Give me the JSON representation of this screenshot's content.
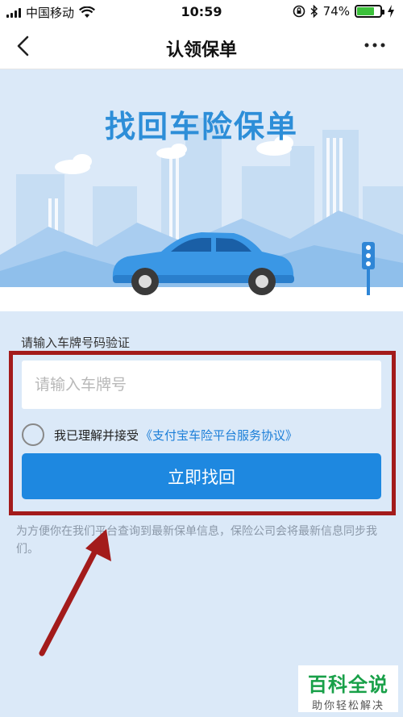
{
  "status_bar": {
    "carrier": "中国移动",
    "time": "10:59",
    "battery": "74%",
    "battery_level": 0.74,
    "icons": [
      "signal-icon",
      "wifi-icon",
      "rotation-lock-icon",
      "bluetooth-icon",
      "battery-icon",
      "charging-icon"
    ]
  },
  "nav": {
    "title": "认领保单",
    "back_icon": "chevron-left-icon",
    "more_icon": "more-dots-icon"
  },
  "banner": {
    "title": "找回车险保单",
    "illustration": "car-city-illustration"
  },
  "form": {
    "label": "请输入车牌号码验证",
    "plate_placeholder": "请输入车牌号",
    "plate_value": "",
    "agree_text": "我已理解并接受",
    "agree_link": "《支付宝车险平台服务协议》",
    "agree_checked": false,
    "submit_label": "立即找回"
  },
  "note": "为方便你在我们平台查询到最新保单信息，保险公司会将最新信息同步我们。",
  "colors": {
    "accent": "#1e88e0",
    "link": "#1b7ed8",
    "title_blue": "#2d8ed8",
    "background": "#dbe9f8",
    "annotation_red": "#a31b1b"
  },
  "watermark": {
    "main": "百科全说",
    "sub": "助你轻松解决"
  }
}
